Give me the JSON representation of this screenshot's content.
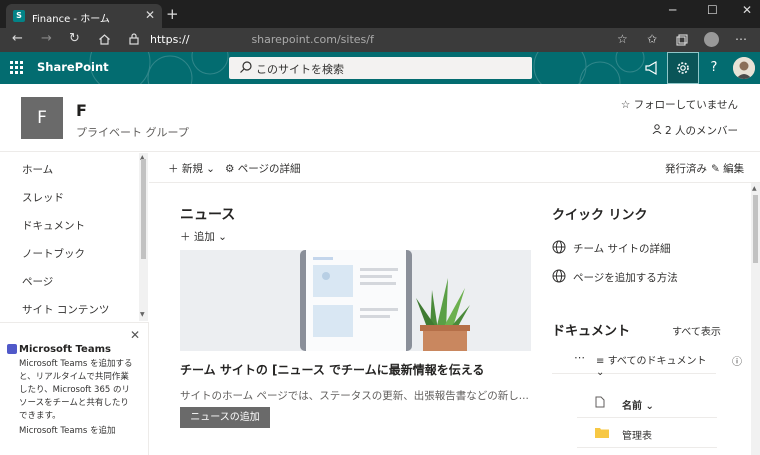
{
  "browser": {
    "tab_title": "Finance - ホーム",
    "tab_favicon": "S",
    "new_tab": "+",
    "url_protocol": "https://",
    "url_rest": "sharepoint.com/sites/f"
  },
  "suite": {
    "brand": "SharePoint",
    "search_placeholder": "このサイトを検索"
  },
  "site": {
    "logo_letter": "F",
    "title": "F",
    "subtitle": "プライベート グループ",
    "follow": "フォローしていません",
    "members": "2 人のメンバー"
  },
  "leftnav": {
    "items": [
      "ホーム",
      "スレッド",
      "ドキュメント",
      "ノートブック",
      "ページ",
      "サイト コンテンツ"
    ]
  },
  "teams": {
    "title": "Microsoft Teams",
    "desc": "Microsoft Teams を追加すると、リアルタイムで共同作業したり、Microsoft 365 のリソースをチームと共有したりできます。",
    "link": "Microsoft Teams を追加"
  },
  "cmdbar": {
    "new": "新規",
    "details": "ページの詳細",
    "published": "発行済み",
    "edit": "編集"
  },
  "news": {
    "heading": "ニュース",
    "add": "追加",
    "title": "チーム サイトの [ニュース でチームに最新情報を伝える",
    "desc": "サイトのホーム ページでは、ステータスの更新、出張報告書などの新し...",
    "add_button": "ニュースの追加"
  },
  "quicklinks": {
    "heading": "クイック リンク",
    "items": [
      "チーム サイトの詳細",
      "ページを追加する方法"
    ]
  },
  "documents": {
    "heading": "ドキュメント",
    "view_all": "すべて表示",
    "more": "⋯",
    "view": "すべてのドキュメント",
    "col_name": "名前",
    "rows": [
      "管理表"
    ]
  },
  "icons": {
    "search": "search-icon",
    "globe": "globe-icon",
    "folder": "folder-icon"
  },
  "colors": {
    "suite": "#036c70",
    "tabbar": "#202020",
    "addrbar": "#3b3b3b",
    "logo": "#6a6a6a"
  }
}
